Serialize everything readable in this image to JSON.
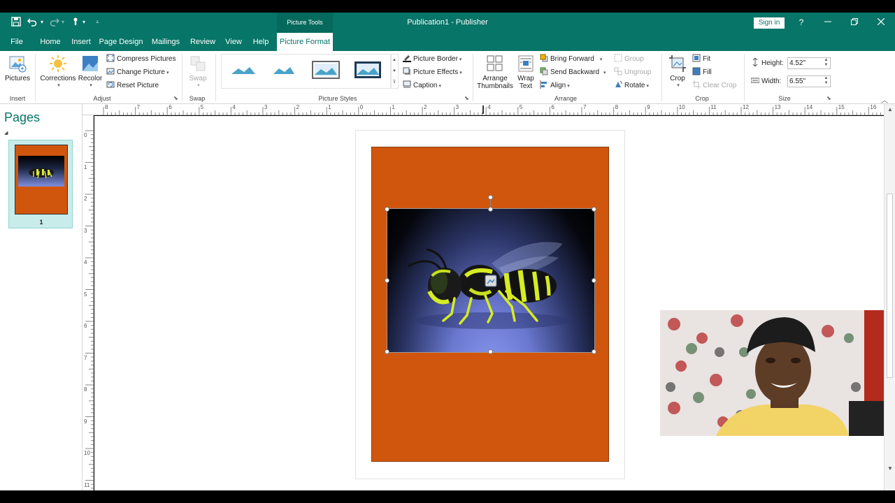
{
  "app": {
    "title": "Publication1  -  Publisher",
    "context_tab_header": "Picture Tools",
    "sign_in": "Sign in",
    "help": "?"
  },
  "tabs": [
    "File",
    "Home",
    "Insert",
    "Page Design",
    "Mailings",
    "Review",
    "View",
    "Help",
    "Picture Format"
  ],
  "active_tab": "Picture Format",
  "ribbon": {
    "insert": {
      "label": "Insert",
      "pictures": "Pictures"
    },
    "adjust": {
      "label": "Adjust",
      "corrections": "Corrections",
      "recolor": "Recolor",
      "compress": "Compress Pictures",
      "change": "Change Picture",
      "reset": "Reset Picture"
    },
    "swap": {
      "label": "Swap",
      "swap": "Swap"
    },
    "styles": {
      "label": "Picture Styles",
      "border": "Picture Border",
      "effects": "Picture Effects",
      "caption": "Caption"
    },
    "arrange": {
      "label": "Arrange",
      "arrange_thumbs_1": "Arrange",
      "arrange_thumbs_2": "Thumbnails",
      "wrap_1": "Wrap",
      "wrap_2": "Text",
      "bring_forward": "Bring Forward",
      "send_backward": "Send Backward",
      "align": "Align",
      "group": "Group",
      "ungroup": "Ungroup",
      "rotate": "Rotate"
    },
    "crop": {
      "label": "Crop",
      "crop": "Crop",
      "fit": "Fit",
      "fill": "Fill",
      "clear": "Clear Crop"
    },
    "size": {
      "label": "Size",
      "height_label": "Height:",
      "height_value": "4.52\"",
      "width_label": "Width:",
      "width_value": "6.55\""
    }
  },
  "ruler": {
    "horizontal": [
      "8",
      "7",
      "6",
      "5",
      "4",
      "3",
      "2",
      "1",
      "0",
      "1",
      "2",
      "3",
      "4",
      "5",
      "6",
      "7",
      "8",
      "9",
      "10",
      "11",
      "12",
      "13",
      "14",
      "15",
      "16"
    ],
    "vertical": [
      "0",
      "1",
      "2",
      "3",
      "4",
      "5",
      "6",
      "7",
      "8",
      "9",
      "10",
      "11"
    ]
  },
  "pages_pane": {
    "title": "Pages",
    "pages": [
      {
        "number": "1"
      }
    ]
  },
  "colors": {
    "brand": "#077568",
    "page_fill": "#d1560d"
  }
}
